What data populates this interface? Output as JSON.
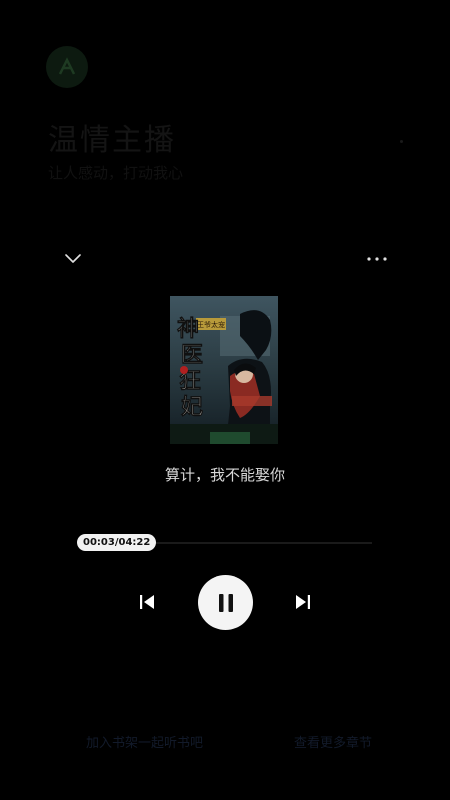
{
  "background": {
    "title": "温情主播",
    "subtitle": "让人感动，打动我心"
  },
  "player": {
    "collapse_icon": "chevron-down-icon",
    "more_icon": "more-horizontal-icon",
    "cover_icon": "book-cover-image",
    "cover_title_lines": [
      "神",
      "医",
      "狂",
      "妃"
    ],
    "cover_banner": "王爷太宠",
    "track_title": "算计，我不能娶你",
    "progress_fraction": 0.011,
    "time_display": "00:03/04:22",
    "prev_icon": "skip-previous-icon",
    "pause_icon": "pause-icon",
    "next_icon": "skip-next-icon"
  },
  "bottom": {
    "left_link": "加入书架一起听书吧",
    "right_link": "查看更多章节"
  },
  "colors": {
    "page_bg": "#000000",
    "pill_bg": "#f2f2f2",
    "control_fg": "#ffffff",
    "pause_bg": "#f4f4f4"
  }
}
